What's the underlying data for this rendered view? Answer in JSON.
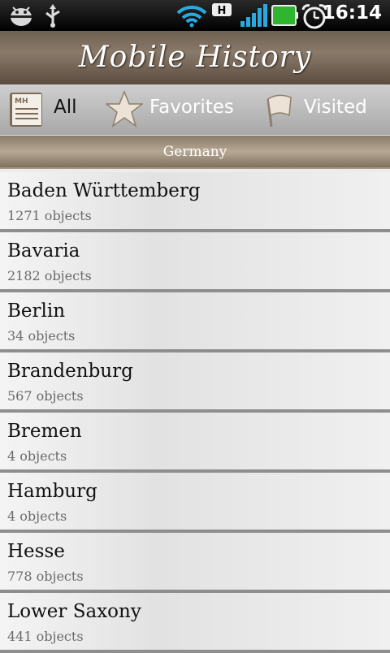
{
  "status_bar": {
    "time": "16:14",
    "icons": [
      "android-debug-icon",
      "usb-icon",
      "wifi-icon",
      "hspa-icon",
      "signal-icon",
      "battery-icon",
      "alarm-clock-icon"
    ],
    "hspa_label": "H"
  },
  "header": {
    "title": "Mobile History",
    "logo_text": "MH"
  },
  "tabs": [
    {
      "label": "All",
      "icon": "book-icon"
    },
    {
      "label": "Favorites",
      "icon": "star-icon"
    },
    {
      "label": "Visited",
      "icon": "flag-icon"
    }
  ],
  "section": {
    "title": "Germany"
  },
  "regions": [
    {
      "name": "Baden Württemberg",
      "count": "1271 objects"
    },
    {
      "name": "Bavaria",
      "count": "2182 objects"
    },
    {
      "name": "Berlin",
      "count": "34 objects"
    },
    {
      "name": "Brandenburg",
      "count": "567 objects"
    },
    {
      "name": "Bremen",
      "count": "4 objects"
    },
    {
      "name": "Hamburg",
      "count": "4 objects"
    },
    {
      "name": "Hesse",
      "count": "778 objects"
    },
    {
      "name": "Lower Saxony",
      "count": "441 objects"
    }
  ],
  "colors": {
    "header": "#6e6052",
    "section": "#9c8c7a",
    "battery": "#2fb52f"
  }
}
